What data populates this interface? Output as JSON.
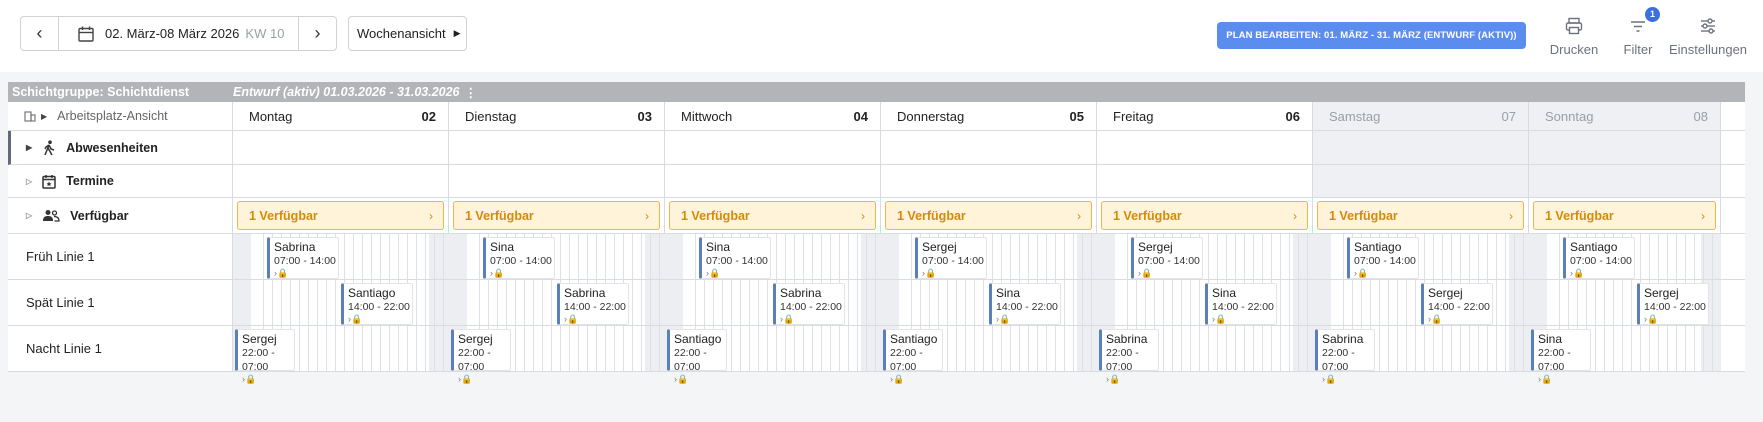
{
  "toolbar": {
    "date_range": "02. März-08 März 2026",
    "week": "KW 10",
    "view": "Wochenansicht",
    "plan_button": "PLAN BEARBEITEN: 01. MÄRZ - 31. MÄRZ (ENTWURF (AKTIV))",
    "print_label": "Drucken",
    "filter_label": "Filter",
    "filter_badge": "1",
    "settings_label": "Einstellungen"
  },
  "group": {
    "name": "Schichtgruppe: Schichtdienst",
    "status": "Entwurf (aktiv) 01.03.2026 - 31.03.2026",
    "menu": "⋮"
  },
  "header": {
    "view_label": "Arbeitsplatz-Ansicht",
    "days": [
      {
        "name": "Montag",
        "num": "02"
      },
      {
        "name": "Dienstag",
        "num": "03"
      },
      {
        "name": "Mittwoch",
        "num": "04"
      },
      {
        "name": "Donnerstag",
        "num": "05"
      },
      {
        "name": "Freitag",
        "num": "06"
      },
      {
        "name": "Samstag",
        "num": "07"
      },
      {
        "name": "Sonntag",
        "num": "08"
      }
    ]
  },
  "sections": {
    "absences": "Abwesenheiten",
    "appointments": "Termine",
    "available": "Verfügbar",
    "available_cells": [
      "1 Verfügbar",
      "1 Verfügbar",
      "1 Verfügbar",
      "1 Verfügbar",
      "1 Verfügbar",
      "1 Verfügbar",
      "1 Verfügbar"
    ]
  },
  "rows": [
    {
      "label": "Früh Linie 1",
      "shifts": [
        {
          "name": "Sabrina",
          "time": "07:00 - 14:00"
        },
        {
          "name": "Sina",
          "time": "07:00 - 14:00"
        },
        {
          "name": "Sina",
          "time": "07:00 - 14:00"
        },
        {
          "name": "Sergej",
          "time": "07:00 - 14:00"
        },
        {
          "name": "Sergej",
          "time": "07:00 - 14:00"
        },
        {
          "name": "Santiago",
          "time": "07:00 - 14:00"
        },
        {
          "name": "Santiago",
          "time": "07:00 - 14:00"
        }
      ]
    },
    {
      "label": "Spät Linie 1",
      "shifts": [
        {
          "name": "Santiago",
          "time": "14:00 - 22:00"
        },
        {
          "name": "Sabrina",
          "time": "14:00 - 22:00"
        },
        {
          "name": "Sabrina",
          "time": "14:00 - 22:00"
        },
        {
          "name": "Sina",
          "time": "14:00 - 22:00"
        },
        {
          "name": "Sina",
          "time": "14:00 - 22:00"
        },
        {
          "name": "Sergej",
          "time": "14:00 - 22:00"
        },
        {
          "name": "Sergej",
          "time": "14:00 - 22:00"
        }
      ]
    },
    {
      "label": "Nacht Linie 1",
      "shifts": [
        {
          "name": "Sergej",
          "time": "22:00 - 07:00"
        },
        {
          "name": "Sergej",
          "time": "22:00 - 07:00"
        },
        {
          "name": "Santiago",
          "time": "22:00 - 07:00"
        },
        {
          "name": "Santiago",
          "time": "22:00 - 07:00"
        },
        {
          "name": "Sabrina",
          "time": "22:00 - 07:00"
        },
        {
          "name": "Sabrina",
          "time": "22:00 - 07:00"
        },
        {
          "name": "Sina",
          "time": "22:00 - 07:00"
        }
      ]
    }
  ],
  "colors": {
    "accent": "#5b8def",
    "available_border": "#f2b34a",
    "available_bg": "#fff3da",
    "shift_bar": "#5b7fb8"
  }
}
